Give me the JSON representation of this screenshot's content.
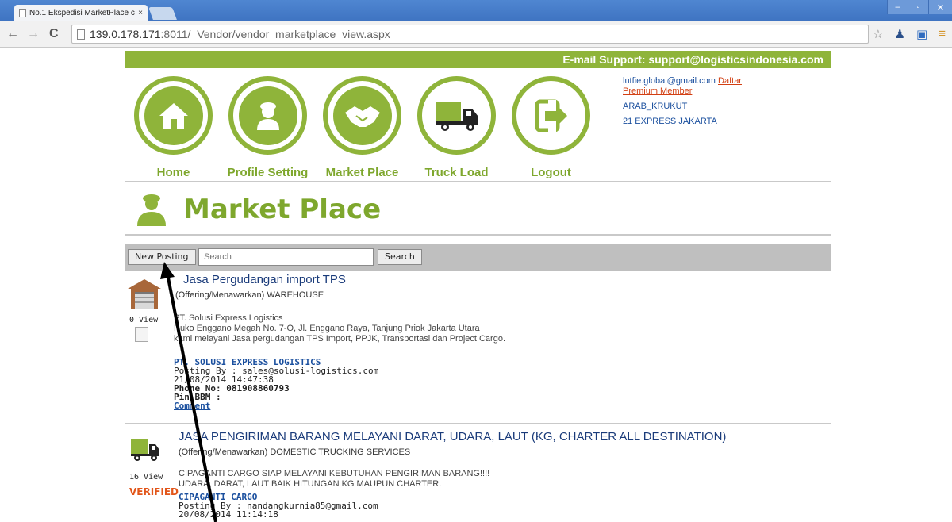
{
  "browser": {
    "tab_title": "No.1 Ekspedisi MarketPlace c",
    "tab_close": "×",
    "url_host": "139.0.178.171",
    "url_path": ":8011/_Vendor/vendor_marketplace_view.aspx"
  },
  "header": {
    "support_text": "E-mail Support: support@logisticsindonesia.com"
  },
  "nav": {
    "items": [
      {
        "label": "Home",
        "icon": "home-icon"
      },
      {
        "label": "Profile Setting",
        "icon": "user-icon"
      },
      {
        "label": "Market Place",
        "icon": "handshake-icon"
      },
      {
        "label": "Truck Load",
        "icon": "truck-icon"
      },
      {
        "label": "Logout",
        "icon": "logout-icon"
      }
    ]
  },
  "user": {
    "email": "lutfie.global@gmail.com",
    "daftar": "Daftar",
    "premium": "Premium Member",
    "company_code": "ARAB_KRUKUT",
    "company_name": "21 EXPRESS JAKARTA"
  },
  "page_title": "Market Place",
  "toolbar": {
    "new_posting": "New Posting",
    "search_placeholder": "Search",
    "search_button": "Search"
  },
  "listings": [
    {
      "title": "Jasa Pergudangan import TPS",
      "subtitle": "(Offering/Menawarkan) WAREHOUSE",
      "views": "0 View",
      "desc1": "PT. Solusi Express Logistics",
      "desc2": "Ruko Enggano Megah No. 7-O, Jl. Enggano Raya, Tanjung Priok Jakarta Utara",
      "desc3": "kami melayani Jasa pergudangan TPS Import, PPJK, Transportasi dan Project Cargo.",
      "company": "PT. SOLUSI EXPRESS LOGISTICS",
      "posting_by": "Posting By : sales@solusi-logistics.com",
      "date": "21/08/2014 14:47:38",
      "phone": "Phone No: 081908860793",
      "pin": "Pin BBM :",
      "comment": "Comment"
    },
    {
      "title": "JASA PENGIRIMAN BARANG MELAYANI DARAT, UDARA, LAUT (KG, CHARTER ALL DESTINATION)",
      "subtitle": "(Offering/Menawarkan) DOMESTIC TRUCKING SERVICES",
      "views": "16 View",
      "verified": "VERIFIED",
      "desc1": "CIPAGANTI CARGO SIAP MELAYANI KEBUTUHAN PENGIRIMAN BARANG!!!!",
      "desc2": "UDARA, DARAT, LAUT BAIK HITUNGAN KG MAUPUN CHARTER.",
      "company": "CIPAGANTI CARGO",
      "posting_by": "Posting By : nandangkurnia85@gmail.com",
      "date": "20/08/2014 11:14:18"
    }
  ],
  "colors": {
    "brand_green": "#8fb43a",
    "link_blue": "#1a4f9e",
    "verified_orange": "#e2561a"
  }
}
